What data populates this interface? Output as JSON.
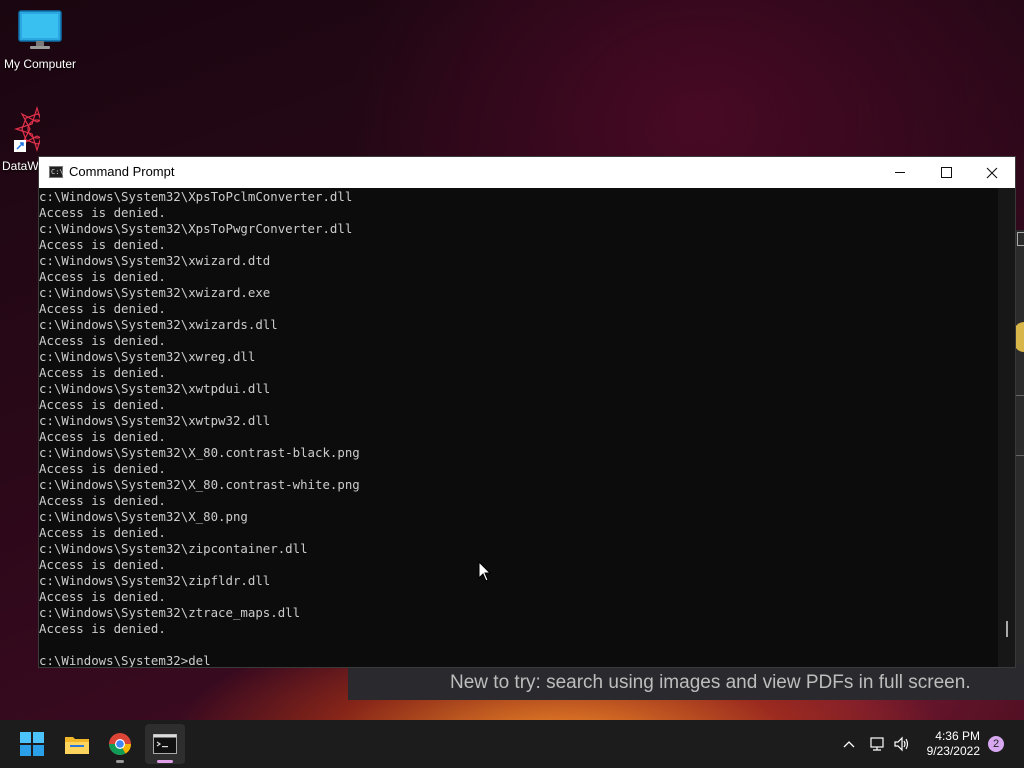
{
  "desktop": {
    "icons": [
      {
        "label": "My Computer"
      },
      {
        "label": "DataW"
      }
    ]
  },
  "background_app": {
    "toast_text": "New to try: search using images and view PDFs in full screen."
  },
  "cmd_window": {
    "title": "Command Prompt",
    "lines": [
      "c:\\Windows\\System32\\XpsToPclmConverter.dll",
      "Access is denied.",
      "c:\\Windows\\System32\\XpsToPwgrConverter.dll",
      "Access is denied.",
      "c:\\Windows\\System32\\xwizard.dtd",
      "Access is denied.",
      "c:\\Windows\\System32\\xwizard.exe",
      "Access is denied.",
      "c:\\Windows\\System32\\xwizards.dll",
      "Access is denied.",
      "c:\\Windows\\System32\\xwreg.dll",
      "Access is denied.",
      "c:\\Windows\\System32\\xwtpdui.dll",
      "Access is denied.",
      "c:\\Windows\\System32\\xwtpw32.dll",
      "Access is denied.",
      "c:\\Windows\\System32\\X_80.contrast-black.png",
      "Access is denied.",
      "c:\\Windows\\System32\\X_80.contrast-white.png",
      "Access is denied.",
      "c:\\Windows\\System32\\X_80.png",
      "Access is denied.",
      "c:\\Windows\\System32\\zipcontainer.dll",
      "Access is denied.",
      "c:\\Windows\\System32\\zipfldr.dll",
      "Access is denied.",
      "c:\\Windows\\System32\\ztrace_maps.dll",
      "Access is denied.",
      "",
      "c:\\Windows\\System32>del"
    ]
  },
  "taskbar": {
    "apps": [
      {
        "name": "start-icon"
      },
      {
        "name": "file-explorer-icon"
      },
      {
        "name": "chrome-icon"
      },
      {
        "name": "command-prompt-icon"
      }
    ],
    "clock_time": "4:36 PM",
    "clock_date": "9/23/2022",
    "notification_count": "2"
  }
}
